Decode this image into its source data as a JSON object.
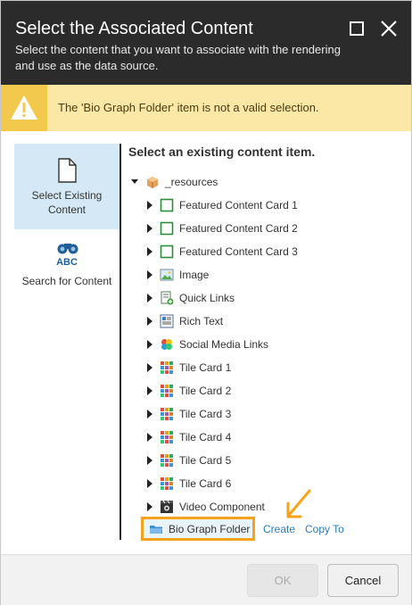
{
  "dialog": {
    "title": "Select the Associated Content",
    "subtitle": "Select the content that you want to associate with the rendering and use as the data source."
  },
  "warning": {
    "message": "The 'Bio Graph Folder' item is not a valid selection."
  },
  "nav": {
    "select_existing": "Select Existing Content",
    "search_content": "Search for Content",
    "search_icon_text": "ABC"
  },
  "content": {
    "heading": "Select an existing content item.",
    "root": "_resources",
    "items": [
      {
        "label": "Featured Content Card 1",
        "icon": "card-outline-icon"
      },
      {
        "label": "Featured Content Card 2",
        "icon": "card-outline-icon"
      },
      {
        "label": "Featured Content Card 3",
        "icon": "card-outline-icon"
      },
      {
        "label": "Image",
        "icon": "image-icon"
      },
      {
        "label": "Quick Links",
        "icon": "links-icon"
      },
      {
        "label": "Rich Text",
        "icon": "rich-text-icon"
      },
      {
        "label": "Social Media Links",
        "icon": "social-icon"
      },
      {
        "label": "Tile Card 1",
        "icon": "tile-card-icon"
      },
      {
        "label": "Tile Card 2",
        "icon": "tile-card-icon"
      },
      {
        "label": "Tile Card 3",
        "icon": "tile-card-icon"
      },
      {
        "label": "Tile Card 4",
        "icon": "tile-card-icon"
      },
      {
        "label": "Tile Card 5",
        "icon": "tile-card-icon"
      },
      {
        "label": "Tile Card 6",
        "icon": "tile-card-icon"
      },
      {
        "label": "Video Component",
        "icon": "video-icon"
      }
    ],
    "selected": "Bio Graph Folder",
    "create": "Create",
    "copy_to": "Copy To"
  },
  "buttons": {
    "ok": "OK",
    "cancel": "Cancel"
  },
  "colors": {
    "titlebar": "#2b2b2b",
    "warning_bg": "#fbe7a6",
    "warning_icon_bg": "#f2c94c",
    "nav_active": "#d4e9f5",
    "link": "#2a7ab8",
    "highlight": "#f7a21b"
  }
}
